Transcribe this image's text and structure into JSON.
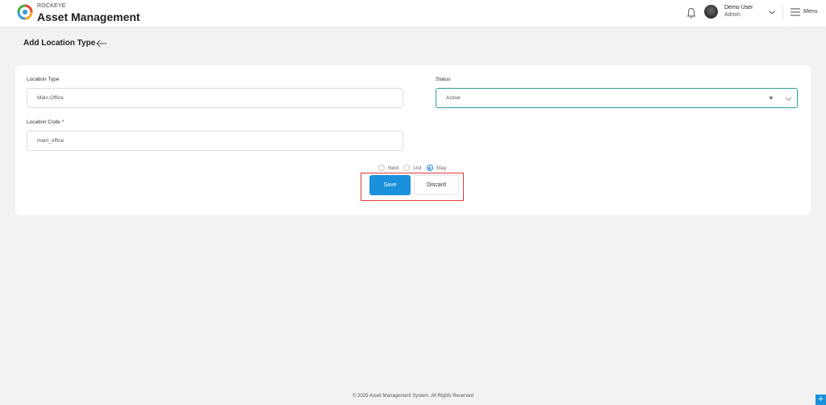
{
  "app": {
    "brand_small": "ROCKEYE",
    "brand_title": "Asset Management"
  },
  "header": {
    "user_name": "Demo User",
    "user_role": "Admin",
    "menu_label": "Menu"
  },
  "page": {
    "title": "Add Location Type"
  },
  "form": {
    "location_type_label": "Location Type",
    "location_type_value": "Main Office",
    "status_label": "Status",
    "status_value": "Active",
    "location_code_label": "Location Code *",
    "location_code_value": "main_office",
    "after_save_options": [
      {
        "label": "Next",
        "checked": false
      },
      {
        "label": "List",
        "checked": false
      },
      {
        "label": "Stay",
        "checked": true
      }
    ],
    "save_label": "Save",
    "discard_label": "Discard"
  },
  "footer": {
    "text": "© 2025 Asset Management System. All Rights Reserved"
  },
  "colors": {
    "accent": "#1a91da",
    "focus_border": "#2aa199",
    "highlight": "#e53935"
  }
}
